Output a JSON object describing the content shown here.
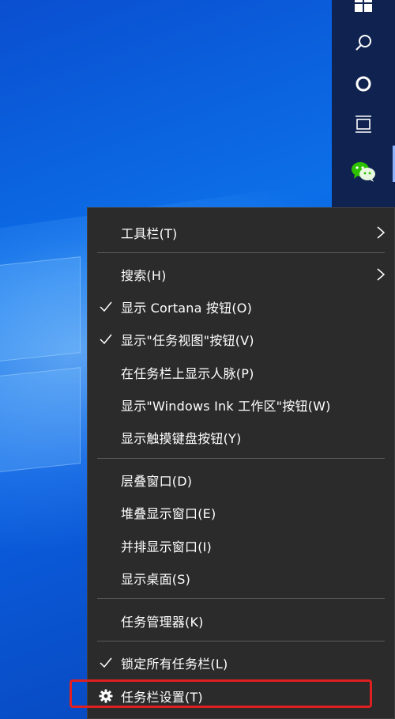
{
  "taskbar": {
    "items": [
      {
        "icon": "windows-start-icon"
      },
      {
        "icon": "search-icon"
      },
      {
        "icon": "cortana-icon"
      },
      {
        "icon": "task-view-icon"
      },
      {
        "icon": "wechat-icon"
      }
    ]
  },
  "context_menu": {
    "items": [
      {
        "label": "工具栏(T)",
        "submenu": true,
        "checked": false
      },
      {
        "label": "搜索(H)",
        "submenu": true,
        "checked": false
      },
      {
        "label": "显示 Cortana 按钮(O)",
        "checked": true
      },
      {
        "label": "显示\"任务视图\"按钮(V)",
        "checked": true
      },
      {
        "label": "在任务栏上显示人脉(P)",
        "checked": false
      },
      {
        "label": "显示\"Windows Ink 工作区\"按钮(W)",
        "checked": false
      },
      {
        "label": "显示触摸键盘按钮(Y)",
        "checked": false
      },
      {
        "label": "层叠窗口(D)",
        "checked": false
      },
      {
        "label": "堆叠显示窗口(E)",
        "checked": false
      },
      {
        "label": "并排显示窗口(I)",
        "checked": false
      },
      {
        "label": "显示桌面(S)",
        "checked": false
      },
      {
        "label": "任务管理器(K)",
        "checked": false
      },
      {
        "label": "锁定所有任务栏(L)",
        "checked": true
      },
      {
        "label": "任务栏设置(T)",
        "checked": false,
        "icon": "gear-icon"
      }
    ]
  },
  "colors": {
    "menu_bg": "#2b2b2b",
    "menu_text": "#ffffff",
    "separator": "#5a5a5a",
    "highlight_border": "#e02020",
    "taskbar_bg": "#102350",
    "desktop_blue": "#0c6fe8"
  }
}
